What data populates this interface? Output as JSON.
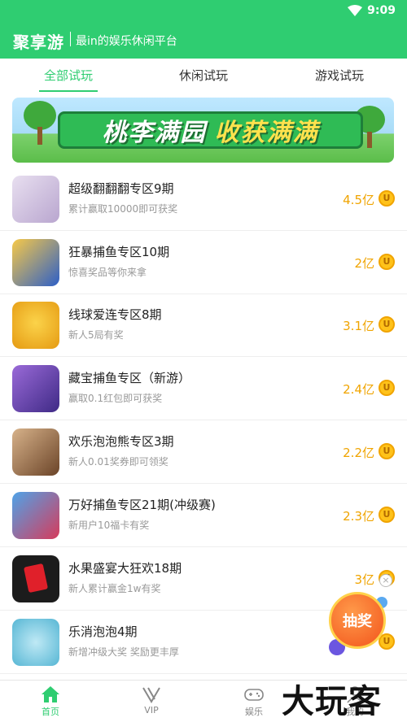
{
  "status": {
    "time": "9:09"
  },
  "header": {
    "brand": "聚享游",
    "slogan": "最in的娱乐休闲平台"
  },
  "tabs": [
    {
      "label": "全部试玩",
      "active": true
    },
    {
      "label": "休闲试玩",
      "active": false
    },
    {
      "label": "游戏试玩",
      "active": false
    }
  ],
  "banner": {
    "part1": "桃李满园",
    "part2": "收获满满"
  },
  "games": [
    {
      "title": "超级翻翻翻专区9期",
      "subtitle": "累计赢取10000即可获奖",
      "reward": "4.5亿",
      "icon": "fantasy-girl-icon",
      "color": "#c9b7d6"
    },
    {
      "title": "狂暴捕鱼专区10期",
      "subtitle": "惊喜奖品等你来拿",
      "reward": "2亿",
      "icon": "shark-fish-icon",
      "color": "#3b6fd1"
    },
    {
      "title": "线球爱连专区8期",
      "subtitle": "新人5局有奖",
      "reward": "3.1亿",
      "icon": "yellow-cat-icon",
      "color": "#f2b41d"
    },
    {
      "title": "藏宝捕鱼专区（新游）",
      "subtitle": "赢取0.1红包即可获奖",
      "reward": "2.4亿",
      "icon": "treasure-warrior-icon",
      "color": "#7a4fc2"
    },
    {
      "title": "欢乐泡泡熊专区3期",
      "subtitle": "新人0.01奖券即可领奖",
      "reward": "2.2亿",
      "icon": "bubble-bear-icon",
      "color": "#8a5a3a"
    },
    {
      "title": "万好捕鱼专区21期(冲级赛)",
      "subtitle": "新用户10福卡有奖",
      "reward": "2.3亿",
      "icon": "fish-hunter-icon",
      "color": "#3a6ec9"
    },
    {
      "title": "水果盛宴大狂欢18期",
      "subtitle": "新人累计赢金1w有奖",
      "reward": "3亿",
      "icon": "red-envelope-icon",
      "color": "#1e1e1e"
    },
    {
      "title": "乐消泡泡4期",
      "subtitle": "新增冲级大奖 奖励更丰厚",
      "reward": "",
      "icon": "bubble-cat-icon",
      "color": "#7fcbe0"
    }
  ],
  "coin_symbol": "U",
  "lottery": {
    "label": "抽奖",
    "close": "×"
  },
  "nav": [
    {
      "label": "首页",
      "active": true
    },
    {
      "label": "VIP",
      "active": false
    },
    {
      "label": "娱乐",
      "active": false
    },
    {
      "label": "我的",
      "active": false
    }
  ],
  "watermark": "大玩客",
  "colors": {
    "primary": "#2fcd71",
    "reward": "#f0a400"
  }
}
